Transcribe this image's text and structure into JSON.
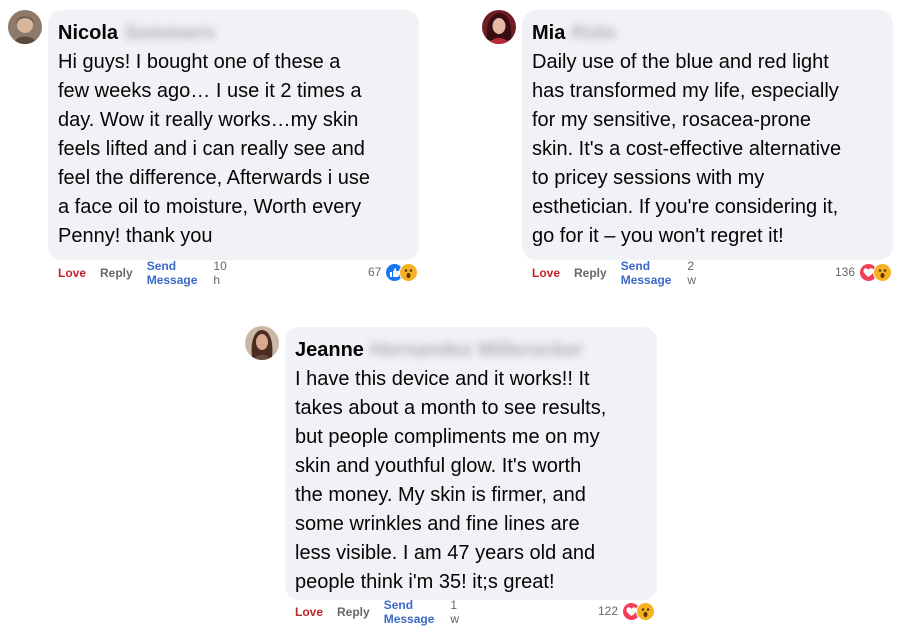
{
  "comments": [
    {
      "name": "Nicola",
      "surname_hidden": "Sommers",
      "text": "Hi guys! I bought one of these a\nfew weeks ago… I use it 2 times a\nday. Wow it really works…my skin\nfeels lifted and i can really see and\nfeel the difference, Afterwards i use\na face oil to moisture, Worth every\nPenny! thank you",
      "actions": {
        "love": "Love",
        "reply": "Reply",
        "send": "Send Message",
        "time": "10 h"
      },
      "reaction_count": "67",
      "reactions": [
        "like-icon",
        "wow-icon"
      ]
    },
    {
      "name": "Mia",
      "surname_hidden": "Rolo",
      "text": "Daily use of the blue and red light\nhas transformed my life, especially\nfor my sensitive, rosacea-prone\nskin. It's a cost-effective alternative\nto pricey sessions with my\nesthetician. If you're considering it,\ngo for it – you won't regret it!",
      "actions": {
        "love": "Love",
        "reply": "Reply",
        "send": "Send Message",
        "time": "2 w"
      },
      "reaction_count": "136",
      "reactions": [
        "love-icon",
        "wow-icon"
      ]
    },
    {
      "name": "Jeanne",
      "surname_hidden": "Hernandez Millerocker",
      "text": "I have this device and it works!! It\ntakes about a month to see results,\nbut people compliments me on my\nskin and youthful glow. It's worth\nthe money. My skin is firmer, and\nsome wrinkles and fine lines are\nless visible. I am 47 years old and\npeople think i'm 35! it;s great!",
      "actions": {
        "love": "Love",
        "reply": "Reply",
        "send": "Send Message",
        "time": "1 w"
      },
      "reaction_count": "122",
      "reactions": [
        "love-icon",
        "wow-icon"
      ]
    }
  ],
  "colors": {
    "bubble": "#f0f2f5",
    "love_action": "#c0232c",
    "send_action": "#3b68c8",
    "like_reaction": "#1877f2",
    "love_reaction": "#f33e58",
    "wow_reaction": "#f7b125"
  }
}
